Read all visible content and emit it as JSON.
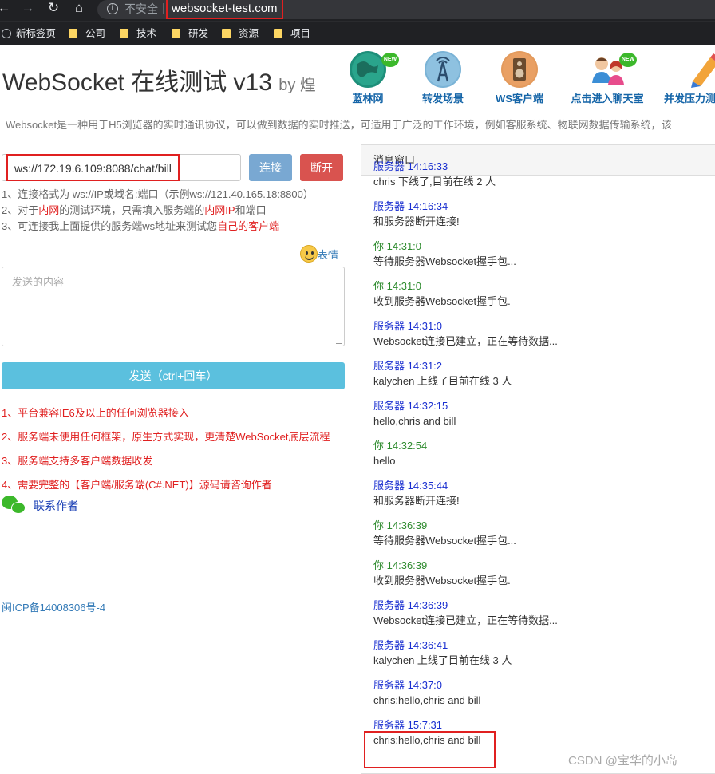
{
  "browser": {
    "security_label": "不安全",
    "url": "websocket-test.com",
    "bookmarks": [
      "新标签页",
      "公司",
      "技术",
      "研发",
      "资源",
      "项目"
    ]
  },
  "header": {
    "title": "WebSocket 在线测试 v13",
    "by": "by 煌",
    "features": [
      {
        "label": "蓝林网",
        "icon": "globe-icon",
        "new": true
      },
      {
        "label": "转发场景",
        "icon": "antenna-icon",
        "new": false
      },
      {
        "label": "WS客户端",
        "icon": "speaker-icon",
        "new": false
      },
      {
        "label": "点击进入聊天室",
        "icon": "chat-users-icon",
        "new": true
      },
      {
        "label": "并发压力测",
        "icon": "pencil-icon",
        "new": false
      }
    ],
    "new_badge": "NEW",
    "description": "Websocket是一种用于H5浏览器的实时通讯协议，可以做到数据的实时推送，可适用于广泛的工作环境，例如客服系统、物联网数据传输系统，该"
  },
  "connect": {
    "ws_url": "ws://172.19.6.109:8088/chat/bill",
    "connect_label": "连接",
    "disconnect_label": "断开"
  },
  "hints": {
    "h1": "1、连接格式为 ws://IP或域名:端口（示例ws://121.40.165.18:8800）",
    "h2_a": "2、对于",
    "h2_b": "内网",
    "h2_c": "的测试环境，只需填入服务端的",
    "h2_d": "内网IP",
    "h2_e": "和端口",
    "h3_a": "3、可连接我上面提供的服务端ws地址来测试您",
    "h3_b": "自己的客户端"
  },
  "compose": {
    "emoji_label": "表情",
    "placeholder": "发送的内容",
    "send_label": "发送（ctrl+回车）"
  },
  "features_list": [
    "1、平台兼容IE6及以上的任何浏览器接入",
    "2、服务端未使用任何框架，原生方式实现，更清楚WebSocket底层流程",
    "3、服务端支持多客户端数据收发",
    "4、需要完整的【客户端/服务端(C#.NET)】源码请咨询作者"
  ],
  "contact_label": "联系作者",
  "icp": "闽ICP备14008306号-4",
  "panel": {
    "title": "消息窗口",
    "messages": [
      {
        "sender": "服务器",
        "time": "14:16:33",
        "text": "chris 下线了,目前在线 2 人",
        "type": "srv"
      },
      {
        "sender": "服务器",
        "time": "14:16:34",
        "text": "和服务器断开连接!",
        "type": "srv"
      },
      {
        "sender": "你",
        "time": "14:31:0",
        "text": "等待服务器Websocket握手包...",
        "type": "me"
      },
      {
        "sender": "你",
        "time": "14:31:0",
        "text": "收到服务器Websocket握手包.",
        "type": "me"
      },
      {
        "sender": "服务器",
        "time": "14:31:0",
        "text": "Websocket连接已建立，正在等待数据...",
        "type": "srv"
      },
      {
        "sender": "服务器",
        "time": "14:31:2",
        "text": "kalychen 上线了目前在线 3 人",
        "type": "srv"
      },
      {
        "sender": "服务器",
        "time": "14:32:15",
        "text": "hello,chris and bill",
        "type": "srv"
      },
      {
        "sender": "你",
        "time": "14:32:54",
        "text": "hello",
        "type": "me"
      },
      {
        "sender": "服务器",
        "time": "14:35:44",
        "text": "和服务器断开连接!",
        "type": "srv"
      },
      {
        "sender": "你",
        "time": "14:36:39",
        "text": "等待服务器Websocket握手包...",
        "type": "me"
      },
      {
        "sender": "你",
        "time": "14:36:39",
        "text": "收到服务器Websocket握手包.",
        "type": "me"
      },
      {
        "sender": "服务器",
        "time": "14:36:39",
        "text": "Websocket连接已建立，正在等待数据...",
        "type": "srv"
      },
      {
        "sender": "服务器",
        "time": "14:36:41",
        "text": "kalychen 上线了目前在线 3 人",
        "type": "srv"
      },
      {
        "sender": "服务器",
        "time": "14:37:0",
        "text": "chris:hello,chris and bill",
        "type": "srv"
      },
      {
        "sender": "服务器",
        "time": "15:7:31",
        "text": "chris:hello,chris and bill",
        "type": "srv"
      }
    ]
  },
  "watermark": "CSDN @宝华的小岛"
}
